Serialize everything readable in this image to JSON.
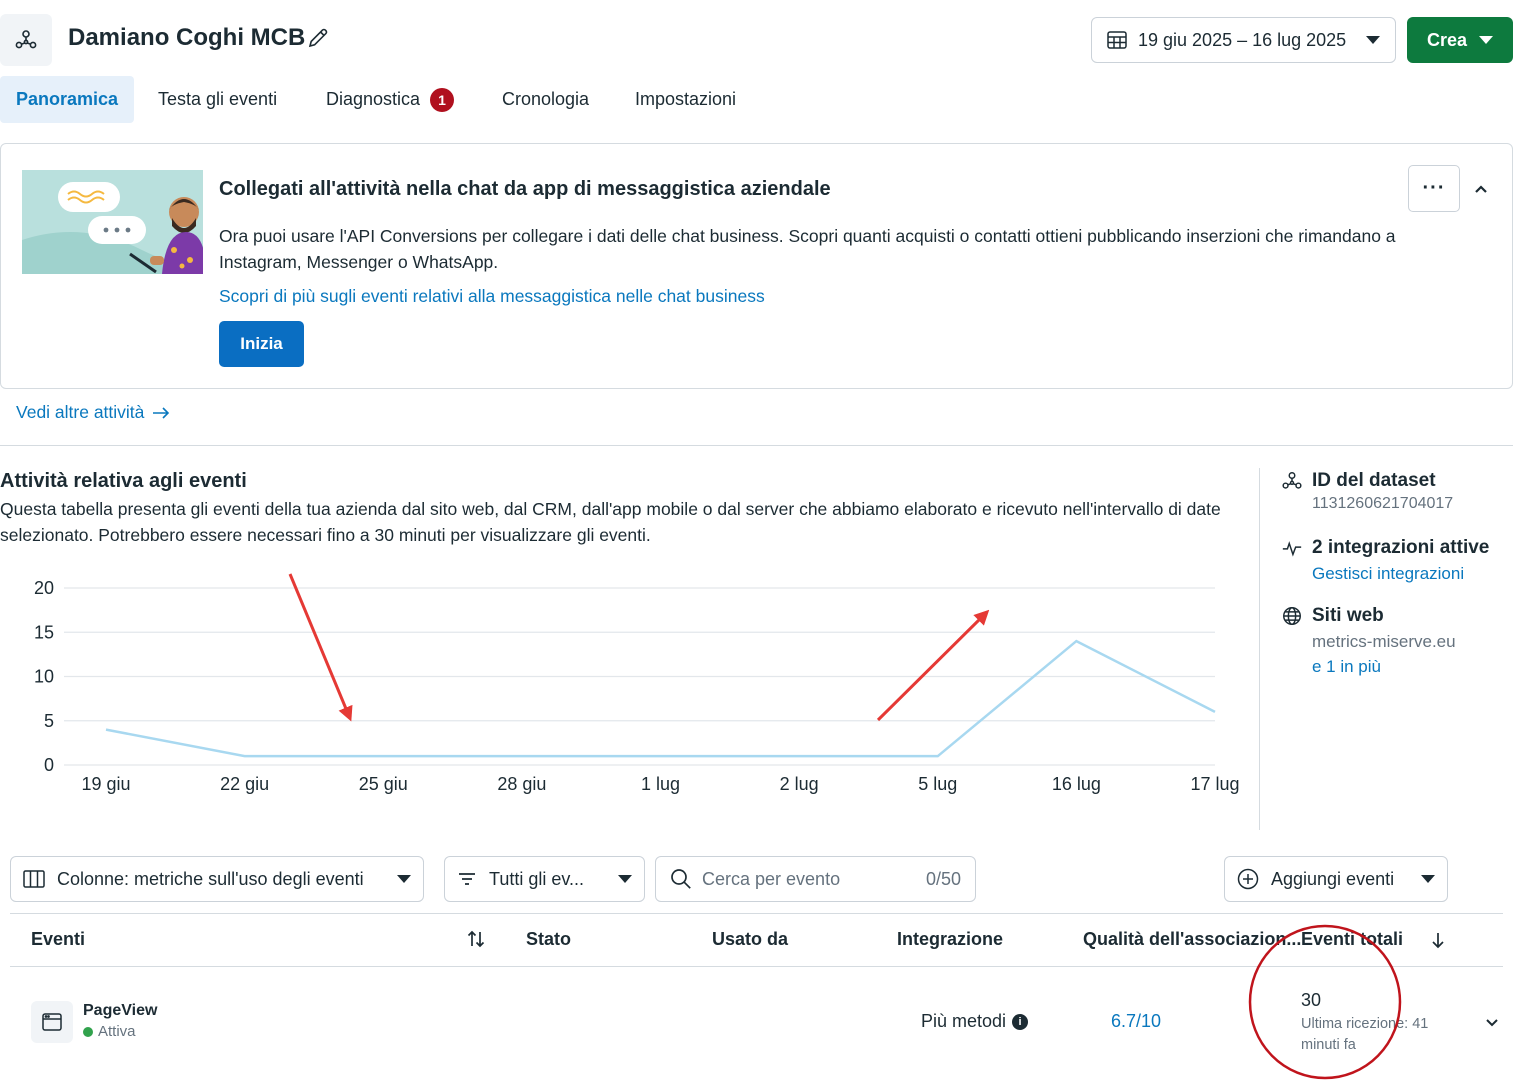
{
  "header": {
    "title": "Damiano Coghi MCB",
    "date_range": "19 giu 2025 – 16 lug 2025",
    "create_label": "Crea"
  },
  "tabs": [
    {
      "label": "Panoramica",
      "active": true
    },
    {
      "label": "Testa gli eventi"
    },
    {
      "label": "Diagnostica",
      "badge": "1"
    },
    {
      "label": "Cronologia"
    },
    {
      "label": "Impostazioni"
    }
  ],
  "promo": {
    "title": "Collegati all'attività nella chat da app di messaggistica aziendale",
    "body": "Ora puoi usare l'API Conversions per collegare i dati delle chat business. Scopri quanti acquisti o contatti ottieni pubblicando inserzioni che rimandano a Instagram, Messenger o WhatsApp.",
    "link": "Scopri di più sugli eventi relativi alla messaggistica nelle chat business",
    "button": "Inizia",
    "more": "···"
  },
  "see_more": "Vedi altre attività",
  "events": {
    "title": "Attività relativa agli eventi",
    "description": "Questa tabella presenta gli eventi della tua azienda dal sito web, dal CRM, dall'app mobile o dal server che abbiamo elaborato e ricevuto nell'intervallo di date selezionato. Potrebbero essere necessari fino a 30 minuti per visualizzare gli eventi."
  },
  "side": {
    "dataset_label": "ID del dataset",
    "dataset_id": "1131260621704017",
    "integrations_label": "2 integrazioni attive",
    "integrations_link": "Gestisci integrazioni",
    "sites_label": "Siti web",
    "site": "metrics-miserve.eu",
    "more_sites": "e 1 in più"
  },
  "chart_data": {
    "type": "line",
    "categories": [
      "19 giu",
      "22 giu",
      "25 giu",
      "28 giu",
      "1 lug",
      "2 lug",
      "5 lug",
      "16 lug",
      "17 lug"
    ],
    "values": [
      4,
      1,
      1,
      1,
      1,
      1,
      1,
      14,
      6
    ],
    "yticks": [
      0,
      5,
      10,
      15,
      20
    ],
    "ylim": [
      0,
      20
    ],
    "grid": true,
    "line_color": "#a8d8f0"
  },
  "toolbar": {
    "columns": "Colonne: metriche sull'uso degli eventi",
    "filter": "Tutti gli ev...",
    "search_placeholder": "Cerca per evento",
    "counter": "0/50",
    "add_events": "Aggiungi eventi"
  },
  "table": {
    "headers": {
      "events": "Eventi",
      "status": "Stato",
      "used_by": "Usato da",
      "integration": "Integrazione",
      "quality": "Qualità dell'associazion...",
      "total": "Eventi totali"
    },
    "row": {
      "name": "PageView",
      "status": "Attiva",
      "integration": "Più metodi",
      "quality": "6.7/10",
      "total": "30",
      "last_received": "Ultima ricezione: 41 minuti fa"
    }
  },
  "colors": {
    "accent": "#0a78be",
    "create": "#0d7a3e",
    "badge": "#b0101e",
    "annotation": "#e53935"
  }
}
